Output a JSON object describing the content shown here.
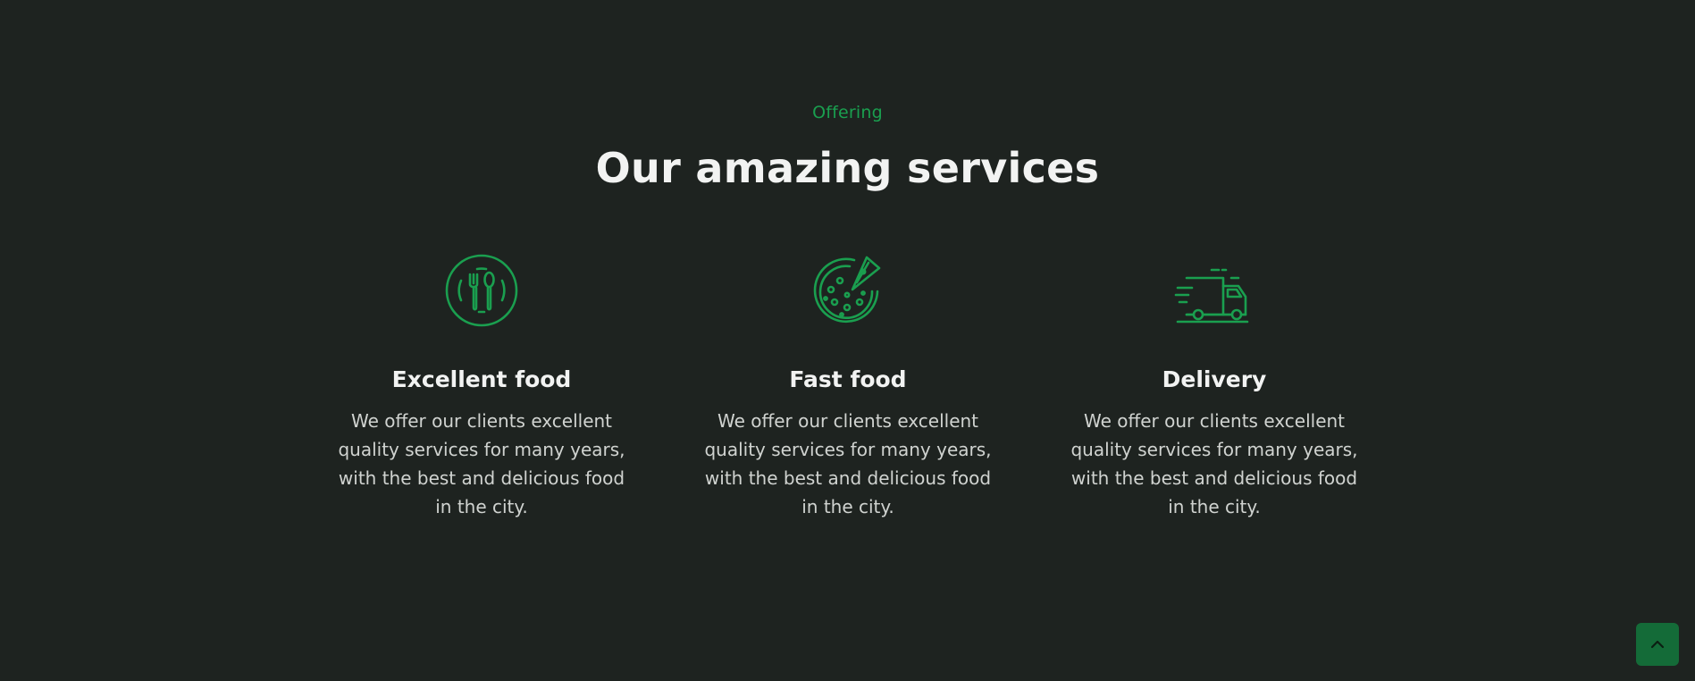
{
  "header": {
    "subtitle": "Offering",
    "title": "Our amazing services"
  },
  "services": [
    {
      "icon": "plate-fork-spoon-icon",
      "title": "Excellent food",
      "description": "We offer our clients excellent quality services for many years, with the best and delicious food in the city."
    },
    {
      "icon": "pizza-icon",
      "title": "Fast food",
      "description": "We offer our clients excellent quality services for many years, with the best and delicious food in the city."
    },
    {
      "icon": "delivery-truck-icon",
      "title": "Delivery",
      "description": "We offer our clients excellent quality services for many years, with the best and delicious food in the city."
    }
  ],
  "scroll_top": {
    "icon": "chevron-up-icon"
  },
  "colors": {
    "background": "#1e2320",
    "accent": "#1a9f4f",
    "button": "#146b38",
    "text": "#f2f3f2"
  }
}
